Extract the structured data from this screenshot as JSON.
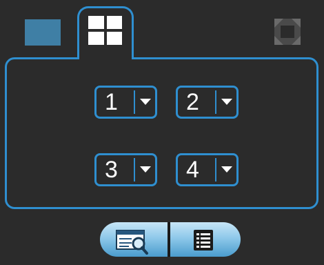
{
  "tabs": [
    {
      "name": "single-view",
      "icon": "single-pane-icon",
      "active": false
    },
    {
      "name": "quad-view",
      "icon": "quad-grid-icon",
      "active": true
    }
  ],
  "fullscreen": {
    "icon": "fullscreen-icon"
  },
  "channels": [
    {
      "label": "1"
    },
    {
      "label": "2"
    },
    {
      "label": "3"
    },
    {
      "label": "4"
    }
  ],
  "bottom_buttons": [
    {
      "icon": "search-playback-icon"
    },
    {
      "icon": "list-icon"
    }
  ],
  "colors": {
    "accent": "#2f8fd0",
    "background": "#2b2b2b",
    "single_tab_fill": "#3f7fa5"
  }
}
